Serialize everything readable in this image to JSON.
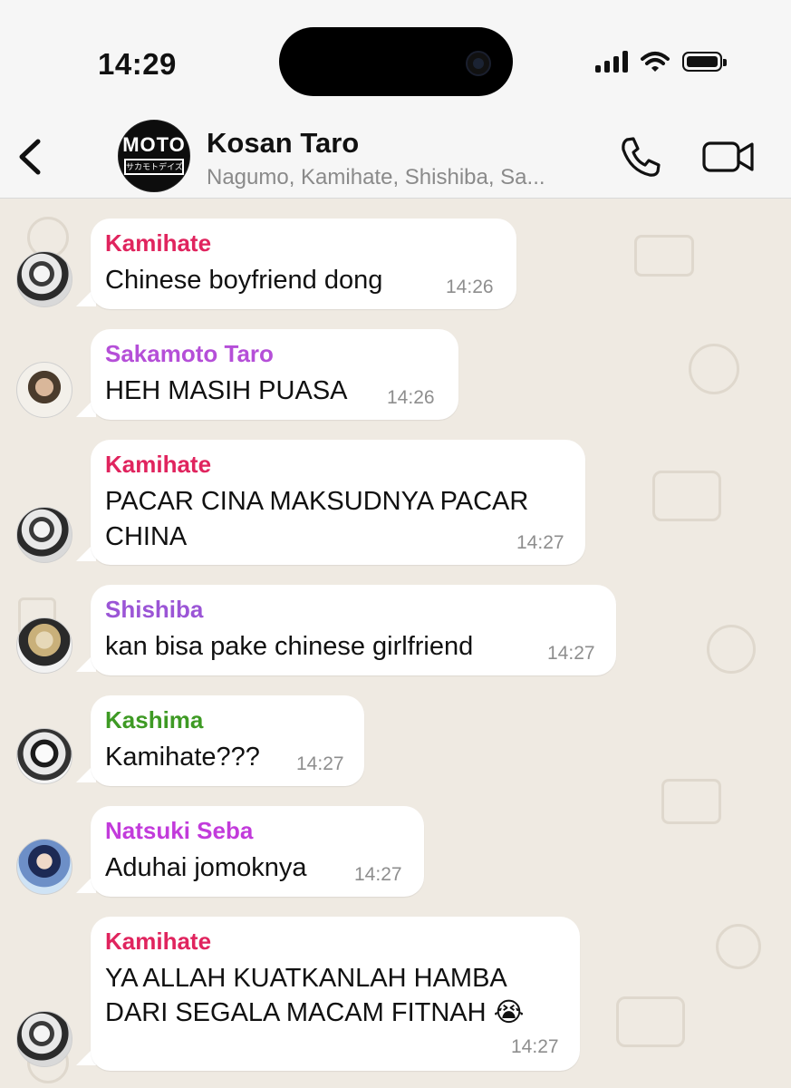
{
  "status_bar": {
    "time": "14:29"
  },
  "header": {
    "group_name": "Kosan Taro",
    "members": "Nagumo, Kamihate, Shishiba, Sa...",
    "avatar_text": "MOTO",
    "avatar_subtext": "サカモトデイズ"
  },
  "messages": [
    {
      "sender": "Kamihate",
      "sender_color": "#e0245e",
      "lines": [
        "Chinese boyfriend dong"
      ],
      "time": "14:26"
    },
    {
      "sender": "Sakamoto Taro",
      "sender_color": "#b54fd8",
      "lines": [
        "HEH MASIH PUASA"
      ],
      "time": "14:26"
    },
    {
      "sender": "Kamihate",
      "sender_color": "#e0245e",
      "lines": [
        "PACAR CINA MAKSUDNYA PACAR",
        "CHINA"
      ],
      "time": "14:27"
    },
    {
      "sender": "Shishiba",
      "sender_color": "#9b55d6",
      "lines": [
        "kan bisa pake chinese girlfriend"
      ],
      "time": "14:27"
    },
    {
      "sender": "Kashima",
      "sender_color": "#3e9a24",
      "lines": [
        "Kamihate???"
      ],
      "time": "14:27"
    },
    {
      "sender": "Natsuki Seba",
      "sender_color": "#c23bdb",
      "lines": [
        "Aduhai jomoknya"
      ],
      "time": "14:27"
    },
    {
      "sender": "Kamihate",
      "sender_color": "#e0245e",
      "lines": [
        "YA ALLAH KUATKANLAH HAMBA",
        "DARI SEGALA MACAM FITNAH 😭"
      ],
      "time": "14:27"
    }
  ]
}
